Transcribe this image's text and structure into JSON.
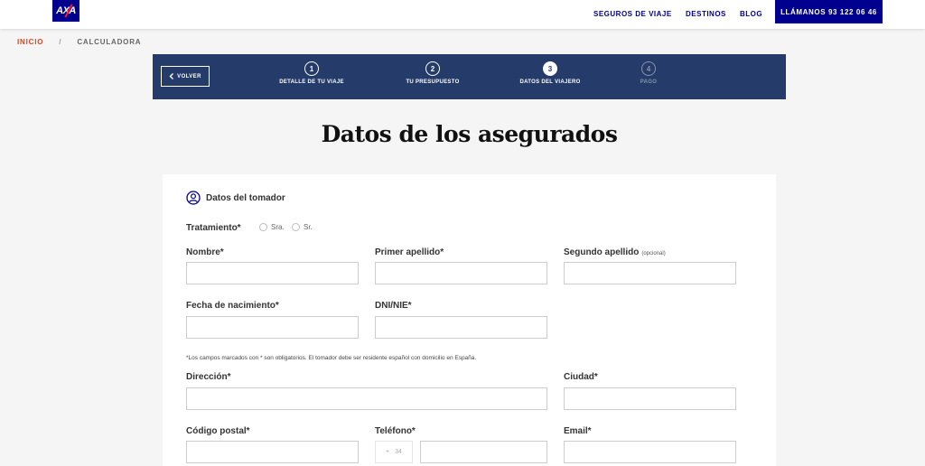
{
  "header": {
    "logo_text": "AXA",
    "nav": [
      "SEGUROS DE VIAJE",
      "DESTINOS",
      "BLOG"
    ],
    "call_label": "LLÁMANOS 93 122 06 46"
  },
  "breadcrumb": {
    "home": "INICIO",
    "separator": "/",
    "current": "CALCULADORA"
  },
  "stepper": {
    "back_label": "VOLVER",
    "steps": [
      {
        "number": "1",
        "label": "DETALLE DE TU VIAJE",
        "state": "completed"
      },
      {
        "number": "2",
        "label": "TU PRESUPUESTO",
        "state": "completed"
      },
      {
        "number": "3",
        "label": "DATOS DEL VIAJERO",
        "state": "active"
      },
      {
        "number": "4",
        "label": "PAGO",
        "state": "disabled"
      }
    ]
  },
  "page_title": "Datos de los asegurados",
  "form": {
    "section_title": "Datos del tomador",
    "tratamiento_label": "Tratamiento*",
    "tratamiento_options": [
      "Sra.",
      "Sr."
    ],
    "nombre_label": "Nombre*",
    "primer_apellido_label": "Primer apellido*",
    "segundo_apellido_label": "Segundo apellido",
    "optional_tag": "(opcional)",
    "fecha_label": "Fecha de nacimiento*",
    "dni_label": "DNI/NIE*",
    "note": "*Los campos marcados con * son obligatorios. El tomador debe ser residente español con domicilio en España.",
    "direccion_label": "Dirección*",
    "ciudad_label": "Ciudad*",
    "cp_label": "Código postal*",
    "telefono_label": "Teléfono*",
    "phone_prefix_sign": "+",
    "phone_prefix": "34",
    "email_label": "Email*"
  },
  "colors": {
    "brand_blue": "#00008f",
    "stepper_bg": "#253c6a",
    "breadcrumb_accent": "#d24723",
    "axa_red": "#ff1721"
  }
}
